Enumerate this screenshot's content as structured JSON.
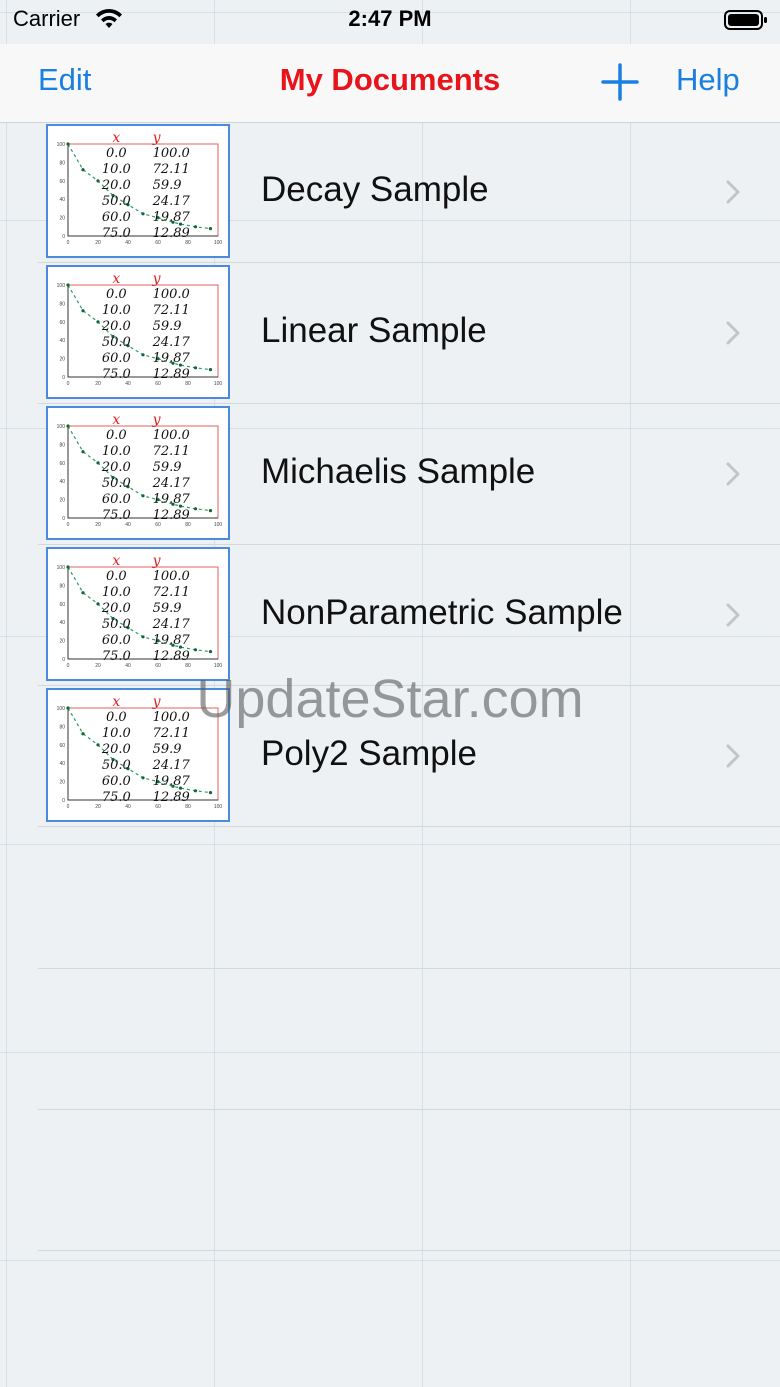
{
  "status_bar": {
    "carrier": "Carrier",
    "time": "2:47 PM"
  },
  "nav": {
    "edit_label": "Edit",
    "title": "My Documents",
    "add_icon": "plus-icon",
    "help_label": "Help"
  },
  "colors": {
    "accent": "#1a7fe0",
    "title": "#e8141b"
  },
  "thumbnail": {
    "header_x": "x",
    "header_y": "y",
    "rows": [
      [
        "0.0",
        "100.0"
      ],
      [
        "10.0",
        "72.11"
      ],
      [
        "20.0",
        "59.9"
      ],
      [
        "50.0",
        "24.17"
      ],
      [
        "60.0",
        "19.87"
      ],
      [
        "75.0",
        "12.89"
      ]
    ],
    "y_ticks": [
      "100",
      "80",
      "60",
      "40",
      "20",
      "0"
    ],
    "x_ticks": [
      "0",
      "20",
      "40",
      "60",
      "80",
      "100"
    ]
  },
  "documents": [
    {
      "name": "Decay Sample"
    },
    {
      "name": "Linear Sample"
    },
    {
      "name": "Michaelis Sample"
    },
    {
      "name": "NonParametric Sample"
    },
    {
      "name": "Poly2 Sample"
    }
  ],
  "watermark": "UpdateStar.com"
}
